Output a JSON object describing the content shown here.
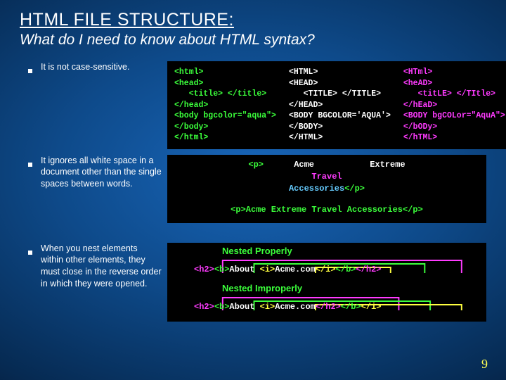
{
  "title": "HTML FILE STRUCTURE:",
  "subtitle": "What do I need to know about HTML syntax?",
  "bullets": {
    "b1": "It is not case-sensitive.",
    "b2": "It ignores all white space in a document other than the single spaces between words.",
    "b3": "When you nest elements within other elements, they must close in the reverse order in which they were opened."
  },
  "code1": {
    "col1": {
      "l1": "<html>",
      "l2": "<head>",
      "l3": "   <title> </title>",
      "l4": "</head>",
      "l5": "<body bgcolor=\"aqua\">",
      "l6": "</body>",
      "l7": "</html>"
    },
    "col2": {
      "l1": "<HTML>",
      "l2": "<HEAD>",
      "l3": "   <TITLE> </TITLE>",
      "l4": "</HEAD>",
      "l5": "<BODY BGCOLOR='AQUA'>",
      "l6": "</BODY>",
      "l7": "</HTML>"
    },
    "col3": {
      "l1": "<HTml>",
      "l2": "<heAD>",
      "l3": "   <titLE> </TItle>",
      "l4": "</hEaD>",
      "l5": "<BODY bgCOLor=\"AquA\">",
      "l6": "</bODy>",
      "l7": "</hTML>"
    }
  },
  "code2": {
    "p_open": "<p>",
    "w1": "Acme",
    "w2": "Extreme",
    "w3": "Travel",
    "w4": "Accessories",
    "p_close": "</p>",
    "line2": "<p>Acme Extreme Travel Accessories</p>"
  },
  "code3": {
    "label_ok": "Nested Properly",
    "ok_h2o": "<h2>",
    "ok_bo": "<b>",
    "ok_t1": "About ",
    "ok_io": "<i>",
    "ok_t2": "Acme.com",
    "ok_ic": "</i>",
    "ok_bc": "</b>",
    "ok_h2c": "</h2>",
    "label_bad": "Nested Improperly",
    "bad_h2o": "<h2>",
    "bad_bo": "<b>",
    "bad_t1": "About ",
    "bad_io": "<i>",
    "bad_t2": "Acme.com",
    "bad_h2c": "</h2>",
    "bad_bc": "</b>",
    "bad_ic": "</i>"
  },
  "page": "9"
}
